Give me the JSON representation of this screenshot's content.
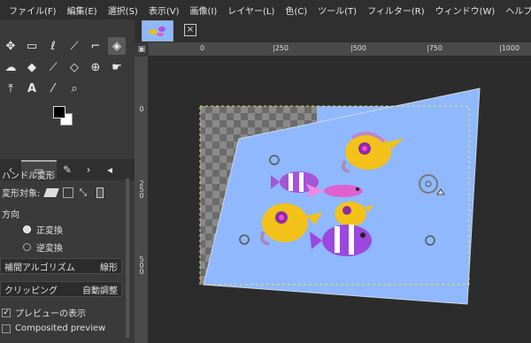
{
  "menu": [
    "ファイル(F)",
    "編集(E)",
    "選択(S)",
    "表示(V)",
    "画像(I)",
    "レイヤー(L)",
    "色(C)",
    "ツール(T)",
    "フィルター(R)",
    "ウィンドウ(W)",
    "ヘルプ(H)"
  ],
  "options": {
    "title": "ハンドル変形",
    "transform_label": "変形対象:",
    "direction_label": "方向",
    "forward": "正変換",
    "backward": "逆変換",
    "interpolation_label": "補間アルゴリズム",
    "interpolation_value": "線形",
    "clipping_label": "クリッピング",
    "clipping_value": "自動調整",
    "show_preview": "プレビューの表示",
    "composited_preview": "Composited preview"
  },
  "ruler": {
    "top": [
      "0",
      "|250",
      "|500",
      "|750",
      "|1000"
    ],
    "left": [
      "0",
      "2 5 0",
      "5 0 0"
    ]
  },
  "image_tab": {
    "close": "×"
  },
  "colors": {
    "accent": "#8fb8ff",
    "canvas_bg": "#2c2c2c"
  },
  "icons": [
    "move-icon",
    "rect-select-icon",
    "lasso-icon",
    "fuzzy-select-icon",
    "crop-icon",
    "handle-transform-icon",
    "warp-icon",
    "bucket-fill-icon",
    "paintbrush-icon",
    "eraser-icon",
    "clone-icon",
    "smudge-icon",
    "paths-icon",
    "text-icon",
    "color-picker-icon",
    "zoom-icon"
  ]
}
